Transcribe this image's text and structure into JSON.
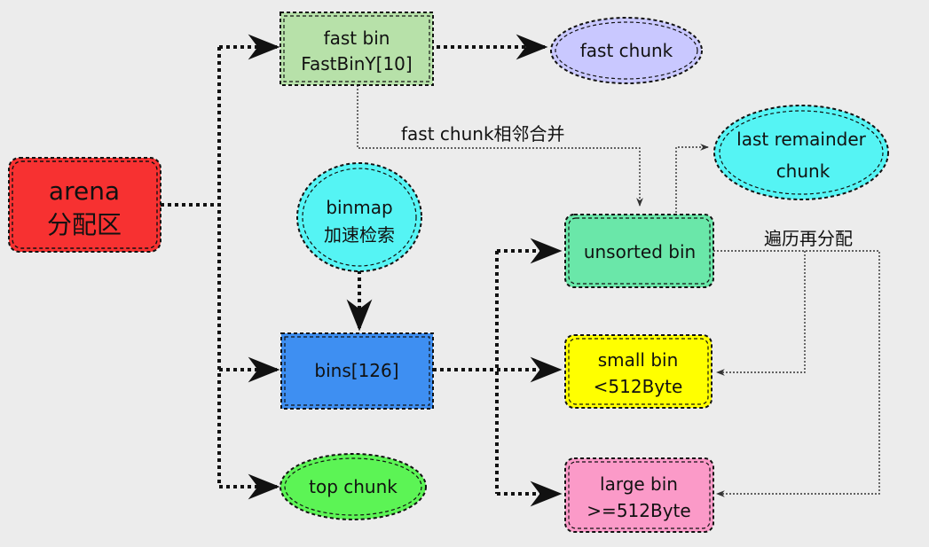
{
  "nodes": {
    "arena": {
      "line1": "arena",
      "line2": "分配区",
      "color": "#f73131"
    },
    "fastbin": {
      "line1": "fast bin",
      "line2": "FastBinY[10]",
      "color": "#b7e1a9"
    },
    "fastchunk": {
      "line1": "fast chunk",
      "color": "#c9c8ff"
    },
    "lastremainder": {
      "line1": "last remainder",
      "line2": "chunk",
      "color": "#55f4f4"
    },
    "binmap": {
      "line1": "binmap",
      "line2": "加速检索",
      "color": "#55f4f4"
    },
    "unsorted": {
      "line1": "unsorted bin",
      "color": "#6ae7a9"
    },
    "bins": {
      "line1": "bins[126]",
      "color": "#3e8ff2"
    },
    "smallbin": {
      "line1": "small bin",
      "line2": "<512Byte",
      "color": "#ffff00"
    },
    "topchunk": {
      "line1": "top chunk",
      "color": "#5cf455"
    },
    "largebin": {
      "line1": "large bin",
      "line2": ">=512Byte",
      "color": "#fb9ac8"
    }
  },
  "edge_labels": {
    "merge": "fast chunk相邻合并",
    "traverse": "遍历再分配"
  }
}
